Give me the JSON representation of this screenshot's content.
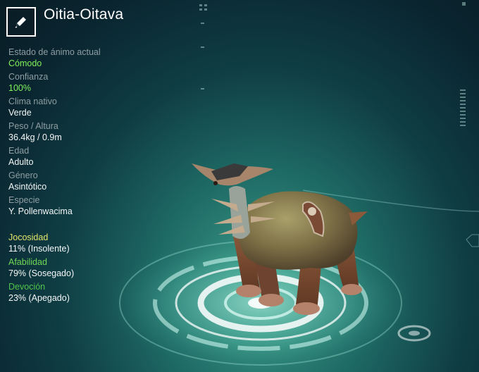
{
  "header": {
    "edit_icon": "pencil-icon",
    "creature_name": "Oitia-Oitava"
  },
  "stats": [
    {
      "label": "Estado de ánimo actual",
      "value": "Cómodo",
      "highlight": true
    },
    {
      "label": "Confianza",
      "value": "100%",
      "highlight": true
    },
    {
      "label": "Clima nativo",
      "value": "Verde"
    },
    {
      "label": "Peso / Altura",
      "value": "36.4kg / 0.9m"
    },
    {
      "label": "Edad",
      "value": "Adulto"
    },
    {
      "label": "Género",
      "value": "Asintótico"
    },
    {
      "label": "Especie",
      "value": "Y. Pollenwacima"
    }
  ],
  "traits": [
    {
      "label": "Jocosidad",
      "value": "11% (Insolente)",
      "color": "#e4e66a"
    },
    {
      "label": "Afabilidad",
      "value": "79% (Sosegado)",
      "color": "#6fd854"
    },
    {
      "label": "Devoción",
      "value": "23% (Apegado)",
      "color": "#4fc44a"
    }
  ]
}
